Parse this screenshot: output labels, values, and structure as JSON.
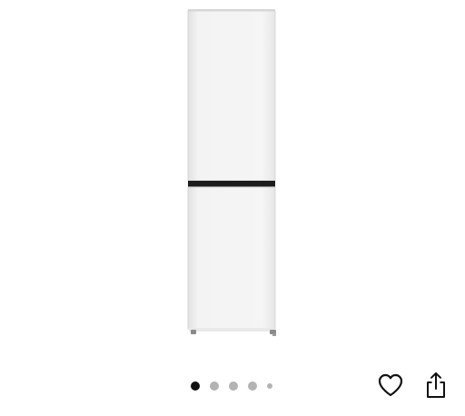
{
  "product": {
    "image_subject": "white-fridge-freezer",
    "colors": {
      "body": "#f2f2f2",
      "body_shade": "#e4e4e4",
      "divider": "#1c1c1c",
      "edge": "#cfcfcf"
    }
  },
  "carousel": {
    "total": 5,
    "active_index": 0,
    "colors": {
      "active": "#111111",
      "inactive": "#b3b3b3"
    }
  },
  "actions": {
    "favorite_icon": "heart-outline-icon",
    "share_icon": "share-up-arrow-icon",
    "icon_color": "#111111"
  }
}
